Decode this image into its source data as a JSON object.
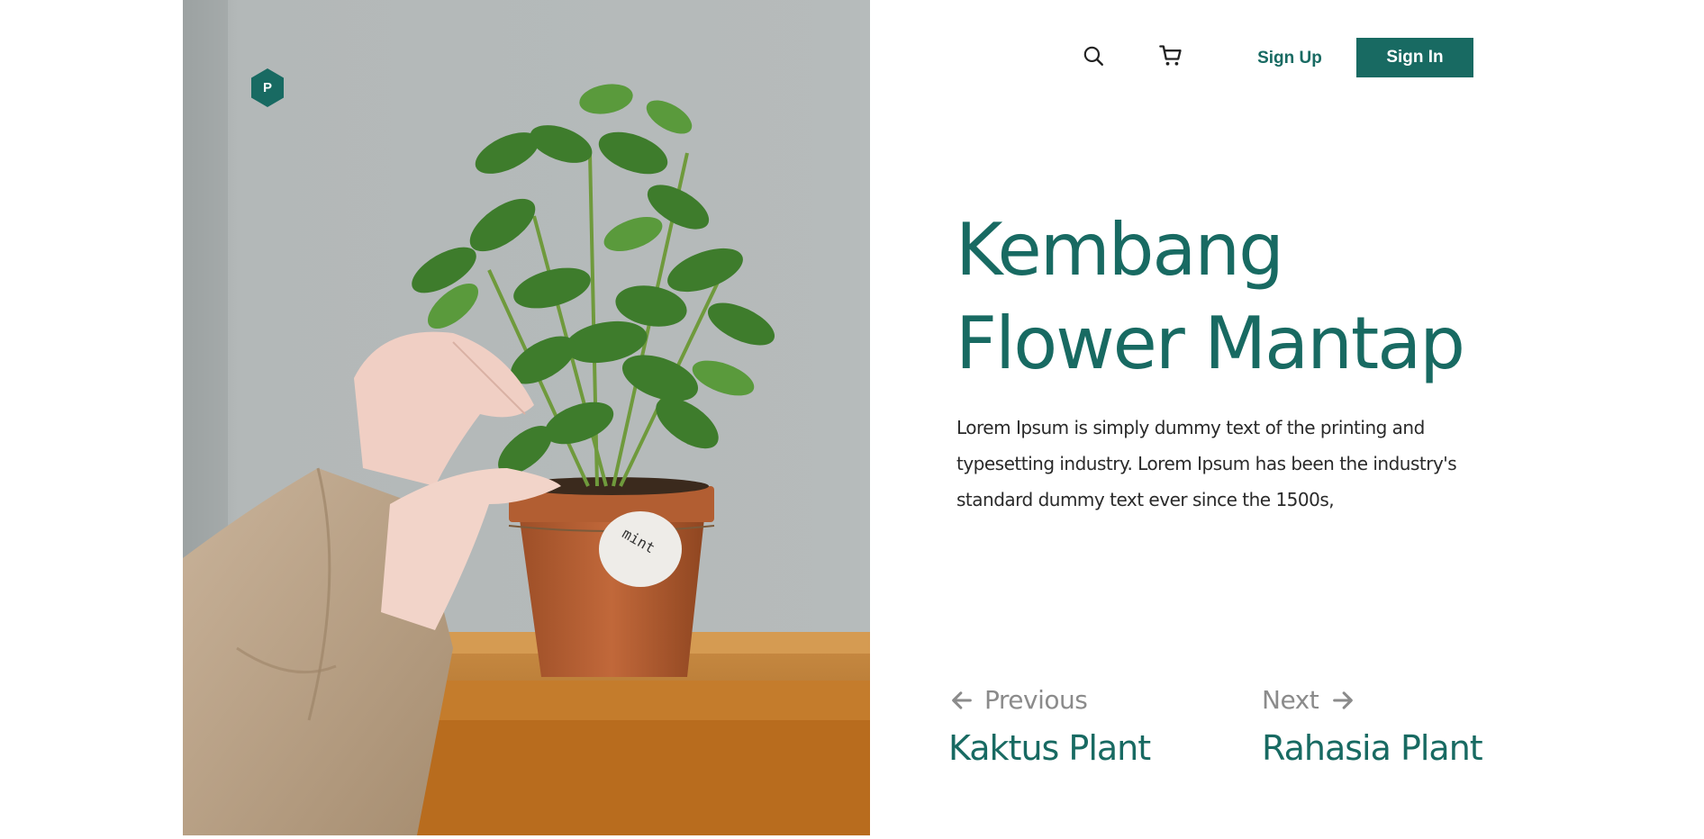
{
  "brand": {
    "logo_letter": "P",
    "accent_color": "#186a62"
  },
  "header": {
    "search_icon": "search-icon",
    "cart_icon": "cart-icon",
    "signup_label": "Sign Up",
    "signin_label": "Sign In"
  },
  "hero": {
    "title_line1": "Kembang",
    "title_line2": "Flower Mantap",
    "description": "Lorem Ipsum is simply dummy text of the printing and typesetting industry. Lorem Ipsum has been the industry's standard dummy text ever since the 1500s,"
  },
  "image": {
    "pot_tag_text": "mint"
  },
  "pager": {
    "previous_label": "Previous",
    "previous_name": "Kaktus Plant",
    "next_label": "Next",
    "next_name": "Rahasia Plant",
    "previous_icon": "arrow-left-icon",
    "next_icon": "arrow-right-icon"
  }
}
